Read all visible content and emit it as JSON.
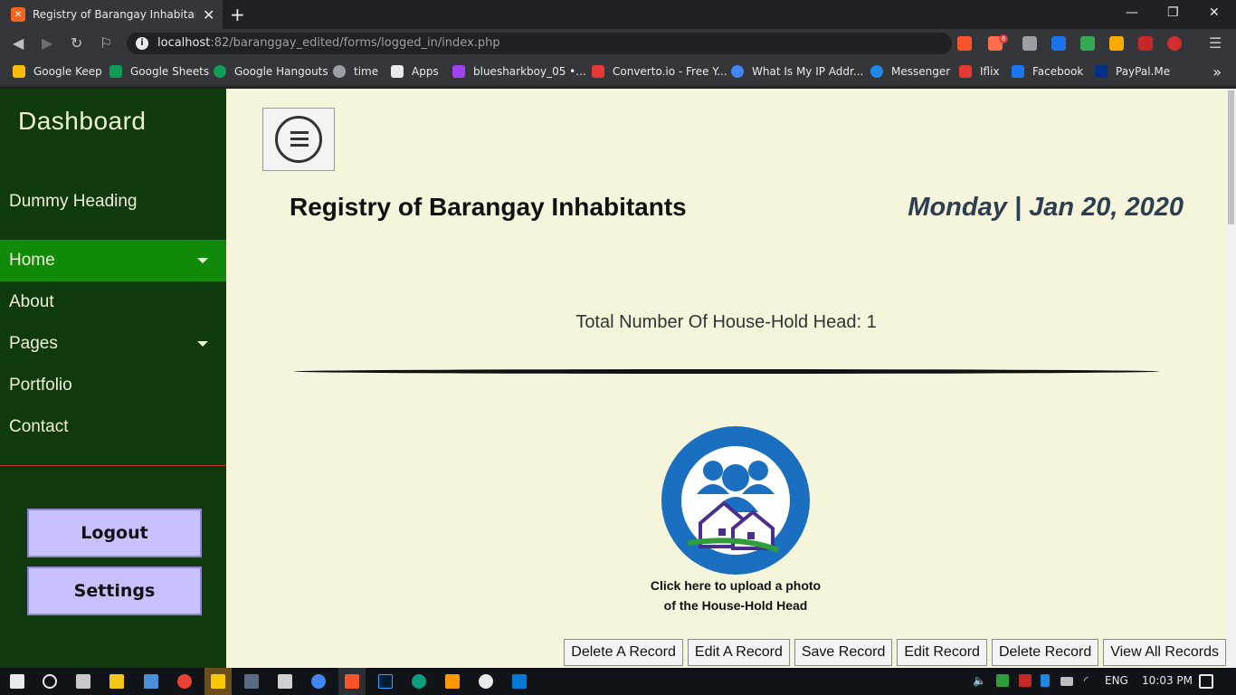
{
  "browser": {
    "tab_title": "Registry of Barangay Inhabitants",
    "tab_close": "✕",
    "new_tab": "+",
    "url_host": "localhost",
    "url_rest": ":82/baranggay_edited/forms/logged_in/index.php",
    "window_controls": [
      "—",
      "❐",
      "✕"
    ],
    "ext_badge": "8",
    "bookmarks": [
      {
        "label": "Google Keep",
        "icon": "google-keep-icon",
        "color": "#fbbc04"
      },
      {
        "label": "Google Sheets",
        "icon": "google-sheets-icon",
        "color": "#0f9d58"
      },
      {
        "label": "Google Hangouts",
        "icon": "google-hangouts-icon",
        "color": "#0f9d58"
      },
      {
        "label": "time",
        "icon": "time-icon",
        "color": "#9aa0a6"
      },
      {
        "label": "Apps",
        "icon": "apps-grid-icon",
        "color": "#e8eaed"
      },
      {
        "label": "bluesharkboy_05 •...",
        "icon": "cube-icon",
        "color": "#a142f4"
      },
      {
        "label": "Converto.io - Free Y...",
        "icon": "converto-icon",
        "color": "#e53935"
      },
      {
        "label": "What Is My IP Addr...",
        "icon": "globe-icon",
        "color": "#4285f4"
      },
      {
        "label": "Messenger",
        "icon": "messenger-icon",
        "color": "#1e88e5"
      },
      {
        "label": "Iflix",
        "icon": "iflix-icon",
        "color": "#e53935"
      },
      {
        "label": "Facebook",
        "icon": "facebook-icon",
        "color": "#1877f2"
      },
      {
        "label": "PayPal.Me",
        "icon": "paypal-icon",
        "color": "#003087"
      }
    ],
    "bookmarks_more": "»"
  },
  "sidebar": {
    "title": "Dashboard",
    "subheading": "Dummy Heading",
    "nav": [
      {
        "label": "Home",
        "active": true,
        "dropdown": true
      },
      {
        "label": "About",
        "active": false,
        "dropdown": false
      },
      {
        "label": "Pages",
        "active": false,
        "dropdown": true
      },
      {
        "label": "Portfolio",
        "active": false,
        "dropdown": false
      },
      {
        "label": "Contact",
        "active": false,
        "dropdown": false
      }
    ],
    "logout_label": "Logout",
    "settings_label": "Settings"
  },
  "main": {
    "title": "Registry of Barangay Inhabitants",
    "date": "Monday | Jan 20, 2020",
    "total_label": "Total Number Of House-Hold Head: 1",
    "upload_caption_line1": "Click here to upload a photo",
    "upload_caption_line2": "of the House-Hold Head",
    "actions": [
      "Delete A Record",
      "Edit A Record",
      "Save Record",
      "Edit Record",
      "Delete Record",
      "View All Records"
    ]
  },
  "taskbar": {
    "language": "ENG",
    "time": "10:03 PM"
  },
  "colors": {
    "sidebar_bg": "#0f3a0d",
    "nav_active": "#118a0a",
    "main_bg": "#f5f5dc",
    "button_purple": "#c8c0ff",
    "date_color": "#2c3e50"
  }
}
